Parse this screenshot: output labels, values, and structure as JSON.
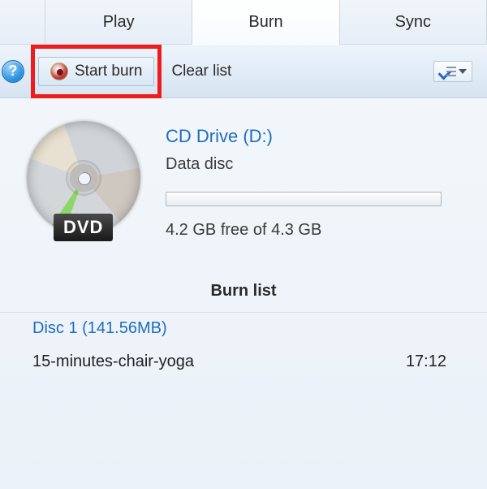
{
  "tabs": {
    "play": "Play",
    "burn": "Burn",
    "sync": "Sync"
  },
  "toolbar": {
    "help_glyph": "?",
    "start_burn": "Start burn",
    "clear_list": "Clear list"
  },
  "drive": {
    "name": "CD Drive (D:)",
    "type": "Data disc",
    "free_space": "4.2 GB free of 4.3 GB",
    "badge": "DVD"
  },
  "burn_list": {
    "header": "Burn list",
    "disc_label": "Disc 1 (141.56MB)",
    "tracks": [
      {
        "title": "15-minutes-chair-yoga",
        "duration": "17:12"
      }
    ]
  }
}
